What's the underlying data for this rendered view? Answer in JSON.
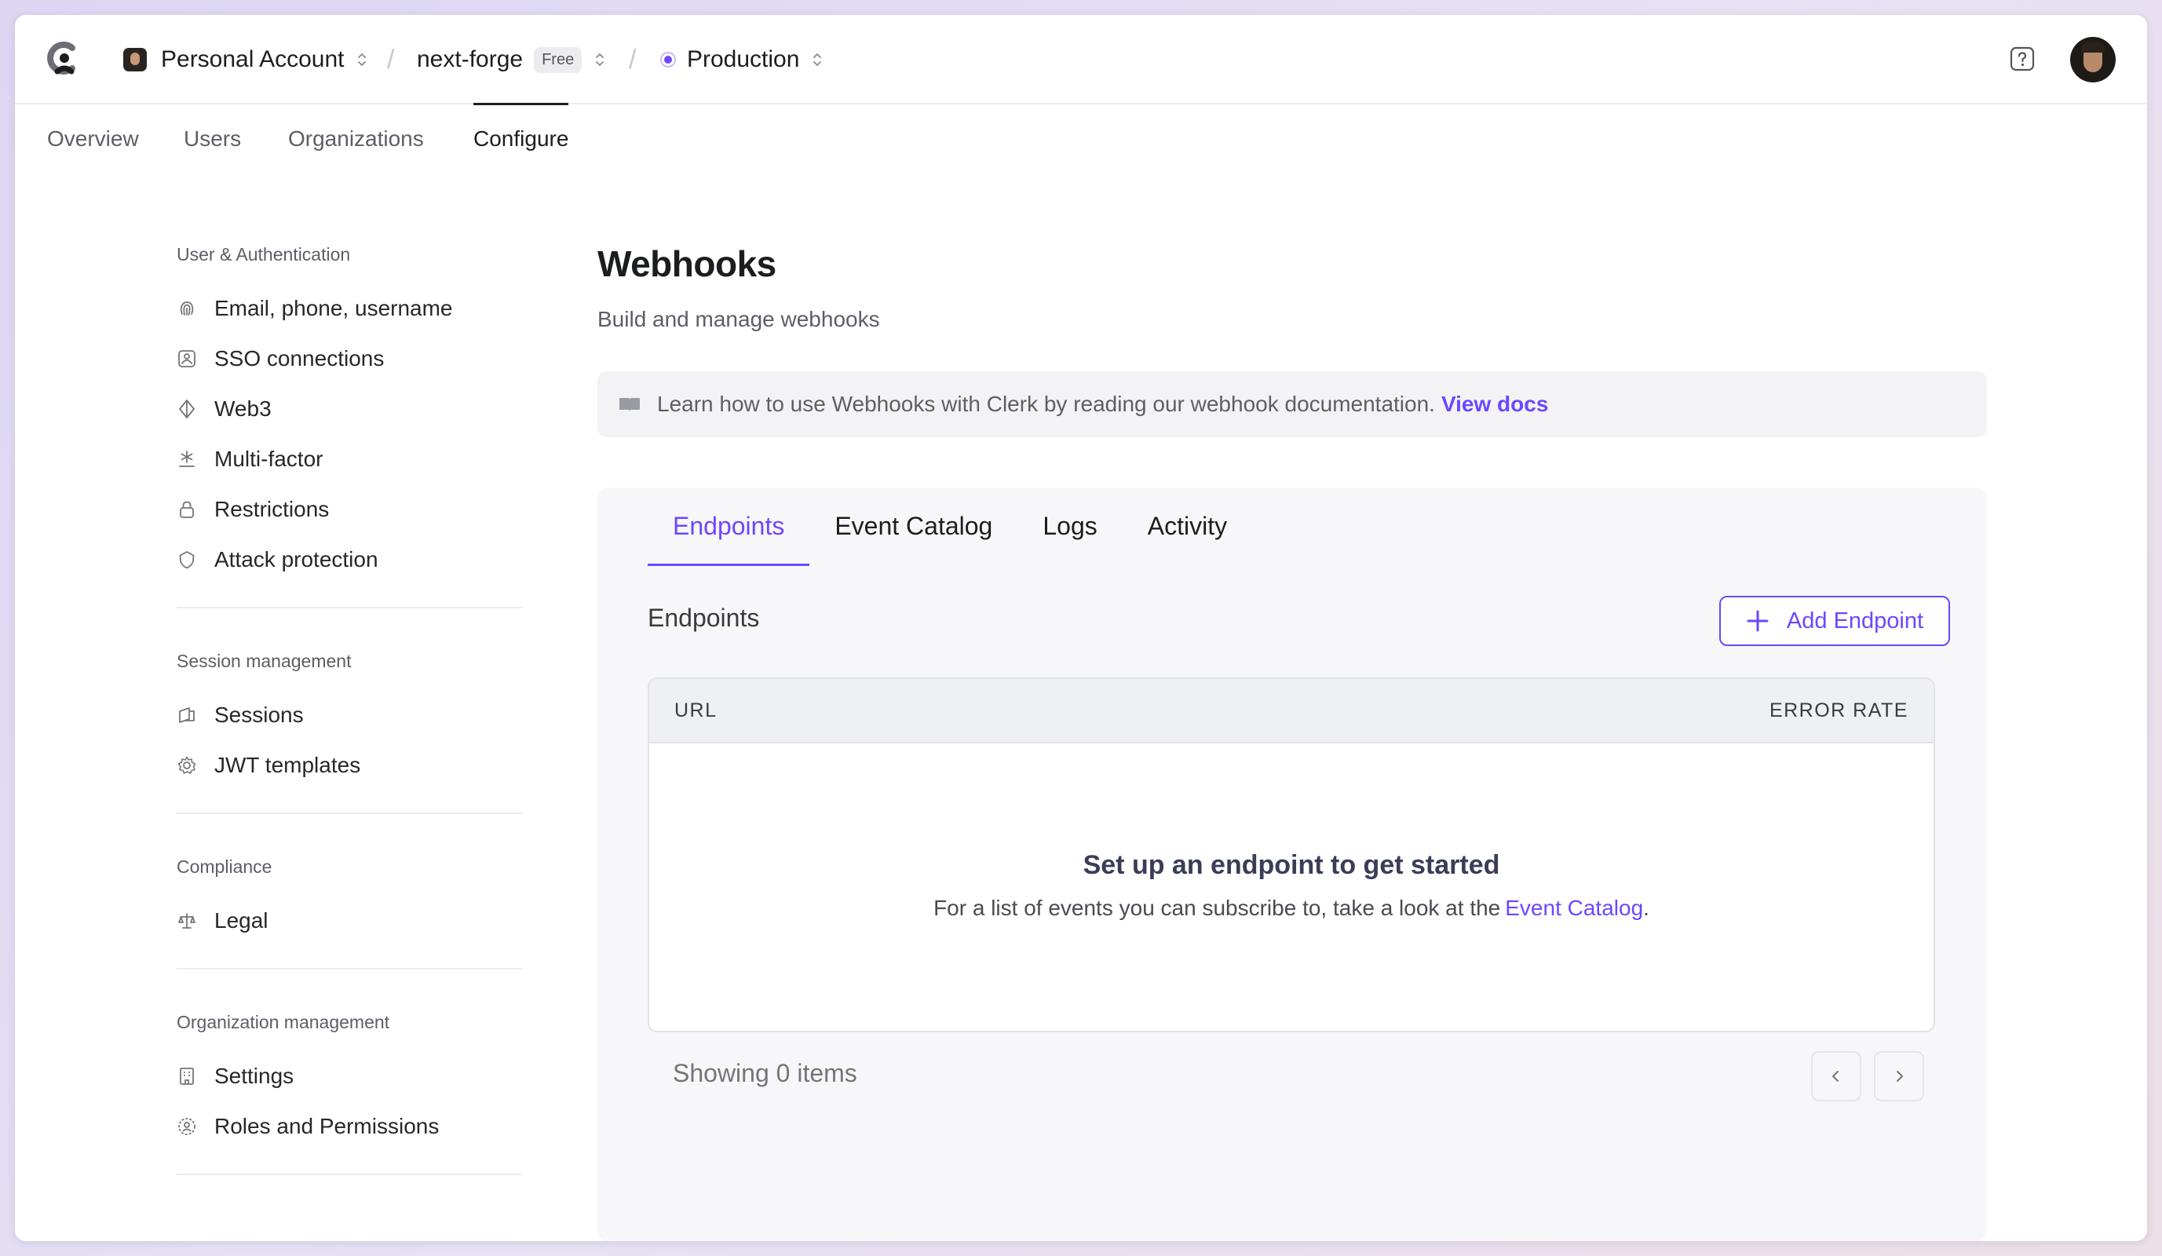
{
  "header": {
    "account": {
      "name": "Personal Account"
    },
    "application": {
      "name": "next-forge",
      "plan": "Free"
    },
    "environment": {
      "name": "Production"
    },
    "accent": "#6c47ff"
  },
  "topnav": [
    "Overview",
    "Users",
    "Organizations",
    "Configure"
  ],
  "sidebar": {
    "sections": [
      {
        "title": "User & Authentication",
        "items": [
          "Email, phone, username",
          "SSO connections",
          "Web3",
          "Multi-factor",
          "Restrictions",
          "Attack protection"
        ]
      },
      {
        "title": "Session management",
        "items": [
          "Sessions",
          "JWT templates"
        ]
      },
      {
        "title": "Compliance",
        "items": [
          "Legal"
        ]
      },
      {
        "title": "Organization management",
        "items": [
          "Settings",
          "Roles and Permissions"
        ]
      }
    ]
  },
  "main": {
    "title": "Webhooks",
    "subtitle": "Build and manage webhooks",
    "info": {
      "text": "Learn how to use Webhooks with Clerk by reading our webhook documentation.",
      "link": "View docs"
    },
    "tabs": [
      "Endpoints",
      "Event Catalog",
      "Logs",
      "Activity"
    ],
    "section_label": "Endpoints",
    "add_button": "Add Endpoint",
    "table": {
      "columns": [
        "URL",
        "ERROR RATE"
      ],
      "empty_title": "Set up an endpoint to get started",
      "empty_text": "For a list of events you can subscribe to, take a look at the",
      "empty_link": "Event Catalog",
      "empty_suffix": "."
    },
    "footer": "Showing 0 items"
  }
}
